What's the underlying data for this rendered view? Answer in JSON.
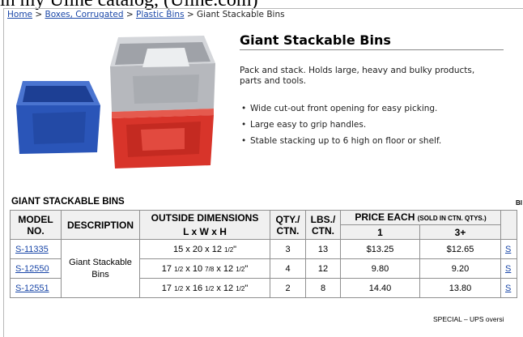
{
  "caption": "in my Uline catalog, (Uline.com)",
  "breadcrumb": {
    "home": "Home",
    "sep1": " > ",
    "boxes": "Boxes, Corrugated",
    "sep2": " > ",
    "plastic": "Plastic Bins",
    "sep3": " > ",
    "current": "Giant Stackable Bins"
  },
  "product": {
    "title": "Giant Stackable Bins",
    "description": "Pack and stack. Holds large, heavy and bulky products, parts and tools.",
    "features": [
      "Wide cut-out front opening for easy picking.",
      "Large easy to grip handles.",
      "Stable stacking up to 6 high on floor or shelf."
    ]
  },
  "section_title": "GIANT STACKABLE BINS",
  "edge_text": "BI",
  "table": {
    "headers": {
      "model": "MODEL NO.",
      "description": "DESCRIPTION",
      "dimensions_line1": "OUTSIDE DIMENSIONS",
      "dimensions_line2": "L x W x H",
      "qty": "QTY./ CTN.",
      "lbs": "LBS./ CTN.",
      "price": "PRICE EACH",
      "price_note": "(SOLD IN CTN. QTYS.)",
      "tier1": "1",
      "tier2": "3+"
    },
    "description": "Giant Stackable Bins",
    "rows": [
      {
        "model": "S-11335",
        "dim_l": "15",
        "dim_l_frac": "",
        "dim_w": "20",
        "dim_w_frac": "",
        "dim_h": "12",
        "dim_h_frac": "1/2",
        "dim_suffix": "\"",
        "qty": "3",
        "lbs": "13",
        "price1": "$13.25",
        "price3": "$12.65",
        "cut": "S"
      },
      {
        "model": "S-12550",
        "dim_l": "17",
        "dim_l_frac": "1/2",
        "dim_w": "10",
        "dim_w_frac": "7/8",
        "dim_h": "12",
        "dim_h_frac": "1/2",
        "dim_suffix": "\"",
        "qty": "4",
        "lbs": "12",
        "price1": "9.80",
        "price3": "9.20",
        "cut": "S"
      },
      {
        "model": "S-12551",
        "dim_l": "17",
        "dim_l_frac": "1/2",
        "dim_w": "16",
        "dim_w_frac": "1/2",
        "dim_h": "12",
        "dim_h_frac": "1/2",
        "dim_suffix": "\"",
        "qty": "2",
        "lbs": "8",
        "price1": "14.40",
        "price3": "13.80",
        "cut": "S"
      }
    ]
  },
  "footnote": "SPECIAL – UPS oversi",
  "colors": {
    "link": "#1a47a8",
    "bin_blue": "#2a55b8",
    "bin_gray": "#b4b6bb",
    "bin_red": "#d8342a"
  }
}
